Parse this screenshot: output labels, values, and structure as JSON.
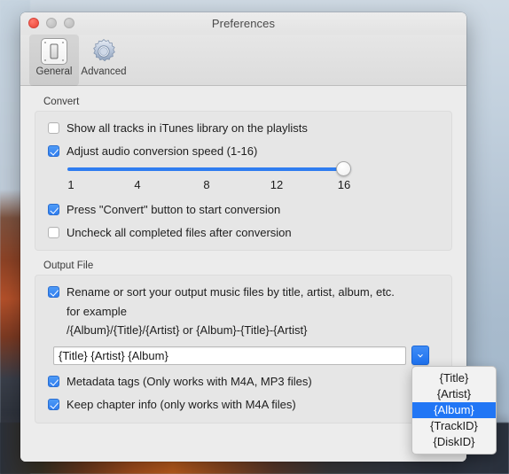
{
  "window": {
    "title": "Preferences",
    "controls": {
      "close": "close-button",
      "minimize": "minimize-button",
      "maximize": "maximize-button"
    }
  },
  "toolbar": {
    "items": [
      {
        "label": "General",
        "icon": "general-icon",
        "selected": true
      },
      {
        "label": "Advanced",
        "icon": "gear-icon",
        "selected": false
      }
    ]
  },
  "convert": {
    "title": "Convert",
    "show_all_tracks": {
      "label": "Show all tracks in iTunes library on the playlists",
      "checked": false
    },
    "adjust_speed": {
      "label": "Adjust audio conversion speed (1-16)",
      "checked": true
    },
    "slider": {
      "min": 1,
      "max": 16,
      "value": 16,
      "ticks": [
        "1",
        "4",
        "8",
        "12",
        "16"
      ]
    },
    "press_convert": {
      "label": "Press \"Convert\" button to start conversion",
      "checked": true
    },
    "uncheck_completed": {
      "label": "Uncheck all completed files after conversion",
      "checked": false
    }
  },
  "output_file": {
    "title": "Output File",
    "rename_sort": {
      "label": "Rename or sort your output music files by title, artist, album, etc.",
      "checked": true
    },
    "example_label": "for example",
    "example_pattern": "/{Album}/{Title}/{Artist} or {Album}-{Title}-{Artist}",
    "pattern_field": {
      "value": "{Title} {Artist} {Album}",
      "placeholder": ""
    },
    "stepper": {
      "icon": "chevron-down-icon"
    },
    "metadata_tags": {
      "label": "Metadata tags (Only works with M4A, MP3 files)",
      "checked": true
    },
    "keep_chapter_info": {
      "label": "Keep chapter info (only works with  M4A files)",
      "checked": true
    }
  },
  "dropdown_menu": {
    "open": true,
    "selected": "{Album}",
    "options": [
      "{Title}",
      "{Artist}",
      "{Album}",
      "{TrackID}",
      "{DiskID}"
    ]
  },
  "colors": {
    "accent_blue": "#2f7df0",
    "menu_highlight": "#2176f5",
    "window_bg": "#ececec",
    "group_bg": "#e6e6e6",
    "close_red": "#f05245"
  }
}
